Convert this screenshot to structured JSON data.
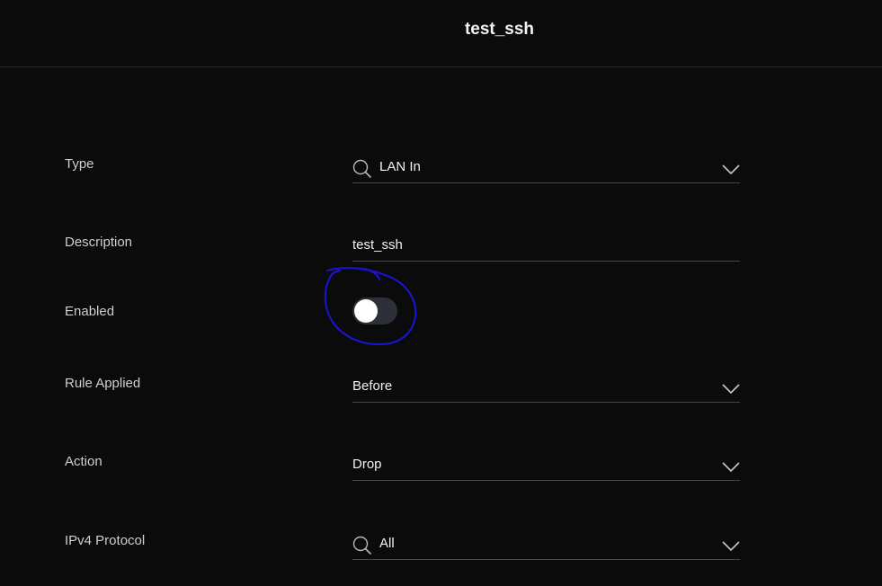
{
  "header": {
    "title": "test_ssh"
  },
  "form": {
    "type": {
      "label": "Type",
      "value": "LAN In",
      "icon": "search-icon"
    },
    "description": {
      "label": "Description",
      "value": "test_ssh"
    },
    "enabled": {
      "label": "Enabled",
      "state": "off"
    },
    "rule_applied": {
      "label": "Rule Applied",
      "value": "Before"
    },
    "action": {
      "label": "Action",
      "value": "Drop"
    },
    "ipv4_protocol": {
      "label": "IPv4 Protocol",
      "value": "All",
      "icon": "search-icon"
    }
  },
  "colors": {
    "background": "#0b0b0c",
    "toggle_track": "#2d3039",
    "annotation_ink": "#1a14c8"
  }
}
